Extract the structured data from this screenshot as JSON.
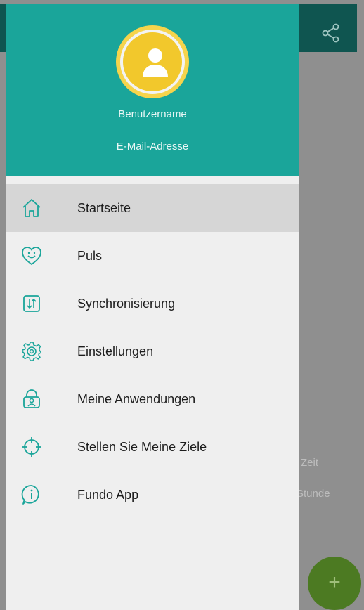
{
  "background": {
    "partial_text_1": "Zeit",
    "partial_text_2": "Stunde",
    "fab_label": "+"
  },
  "drawer": {
    "username": "Benutzername",
    "email": "E-Mail-Adresse",
    "items": [
      {
        "label": "Startseite",
        "icon": "home-icon",
        "active": true
      },
      {
        "label": "Puls",
        "icon": "heart-smile-icon"
      },
      {
        "label": "Synchronisierung",
        "icon": "sync-icon"
      },
      {
        "label": "Einstellungen",
        "icon": "gear-icon"
      },
      {
        "label": "Meine Anwendungen",
        "icon": "user-bag-icon"
      },
      {
        "label": "Stellen Sie Meine Ziele",
        "icon": "target-icon"
      },
      {
        "label": "Fundo App",
        "icon": "info-icon"
      }
    ]
  },
  "colors": {
    "header_teal": "#1aa59a",
    "icon_teal": "#1aa59a",
    "avatar_yellow": "#f2c82c",
    "topbar_dark": "#0f5550",
    "fab_green": "#4c7a22"
  }
}
